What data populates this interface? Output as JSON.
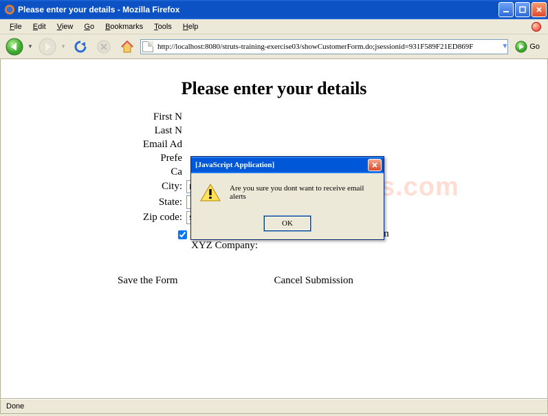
{
  "window": {
    "title": "Please enter your details - Mozilla Firefox"
  },
  "menu": {
    "file": "File",
    "edit": "Edit",
    "view": "View",
    "go": "Go",
    "bookmarks": "Bookmarks",
    "tools": "Tools",
    "help": "Help"
  },
  "navbar": {
    "url": "http://localhost:8080/struts-training-exercise03/showCustomerForm.do;jsessionid=931F589F21ED869F",
    "go": "Go"
  },
  "watermark": "www.java2s.com",
  "page": {
    "heading": "Please enter your details",
    "labels": {
      "first_name": "First N",
      "last_name": "Last N",
      "email": "Email Ad",
      "pref": "Prefe",
      "ca": "Ca",
      "city": "City:",
      "state": "State:",
      "zip": "Zip code:"
    },
    "values": {
      "city": "Regina",
      "state": "Alabama",
      "zip": "S4S 5W5"
    },
    "checkbox_label": "I would like to receive promotional emails from XYZ Company:",
    "checkbox_checked": true,
    "buttons": {
      "save": "Save the Form",
      "cancel": "Cancel Submission"
    }
  },
  "dialog": {
    "title": "[JavaScript Application]",
    "message": "Are you sure you dont want to receive email alerts",
    "ok": "OK"
  },
  "statusbar": {
    "text": "Done"
  }
}
